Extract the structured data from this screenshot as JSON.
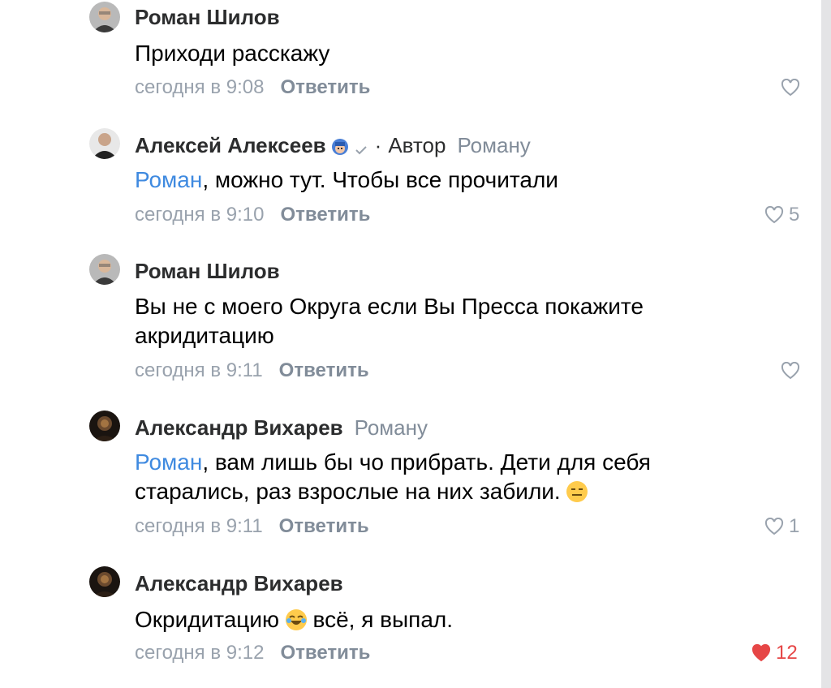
{
  "comments": [
    {
      "author": "Роман Шилов",
      "reply_to": "",
      "text": "Приходи расскажу",
      "time": "сегодня в 9:08",
      "reply_label": "Ответить",
      "likes": ""
    },
    {
      "author": "Алексей Алексеев",
      "author_tag": "Автор",
      "separator": "·",
      "reply_to": "Роману",
      "mention": "Роман",
      "text": ", можно тут. Чтобы все прочитали",
      "time": "сегодня в 9:10",
      "reply_label": "Ответить",
      "likes": "5"
    },
    {
      "author": "Роман Шилов",
      "reply_to": "",
      "text_line1": "Вы не с моего  Округа если Вы Пресса покажите",
      "text_line2": "акридитацию",
      "time": "сегодня в 9:11",
      "reply_label": "Ответить",
      "likes": ""
    },
    {
      "author": "Александр Вихарев",
      "reply_to": "Роману",
      "mention": "Роман",
      "text_line1": ", вам лишь бы чо прибрать. Дети для себя",
      "text_line2": "старались, раз взрослые на них забили.",
      "time": "сегодня в 9:11",
      "reply_label": "Ответить",
      "likes": "1"
    },
    {
      "author": "Александр Вихарев",
      "reply_to": "",
      "text_part1": "Окридитацию",
      "text_part2": "всё, я выпал.",
      "time": "сегодня в 9:12",
      "reply_label": "Ответить",
      "likes": "12",
      "liked": true
    }
  ],
  "colors": {
    "accent": "#3f8ae0",
    "secondary": "#818c99",
    "like_active": "#e64646"
  },
  "icons": [
    "heart-outline-icon",
    "heart-filled-icon",
    "verified-icon",
    "emoji-expressionless-icon",
    "emoji-laughing-icon"
  ]
}
